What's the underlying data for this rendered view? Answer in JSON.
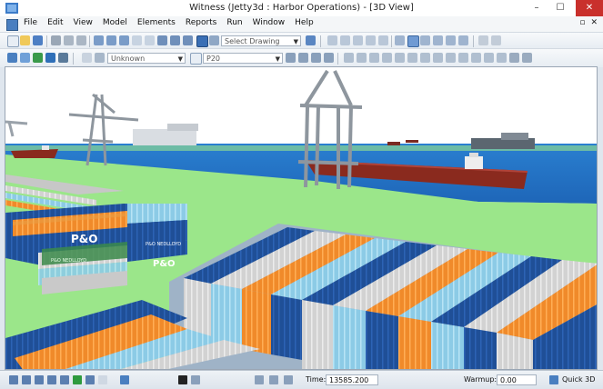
{
  "window": {
    "title": "Witness (Jetty3d : Harbor Operations) - [3D View]",
    "controls": {
      "minimize": "–",
      "maximize": "☐",
      "close": "✕"
    }
  },
  "menu": {
    "items": [
      "File",
      "Edit",
      "View",
      "Model",
      "Elements",
      "Reports",
      "Run",
      "Window",
      "Help"
    ],
    "mdi_controls": {
      "restore": "▫",
      "close": "✕"
    }
  },
  "toolbar1": {
    "drawing_combo": "Select Drawing"
  },
  "toolbar2": {
    "element_combo": "Unknown",
    "layer_combo": "P20"
  },
  "scene": {
    "container_brand": "P&O",
    "stack_text_green": "P&O NEDLLOYD"
  },
  "statusbar": {
    "time_label": "Time:",
    "time_value": "13585.200",
    "warmup_label": "Warmup:",
    "warmup_value": "0.00",
    "quick3d_label": "Quick 3D"
  },
  "colors": {
    "sky": "#ffffff",
    "water": "#2a7fd0",
    "grass": "#9be68a",
    "container_blue": "#1f4f97",
    "container_orange": "#f08a2a",
    "container_light": "#9ed6ee",
    "container_grey": "#d9d9d9",
    "ship_hull": "#8a2a1e"
  }
}
